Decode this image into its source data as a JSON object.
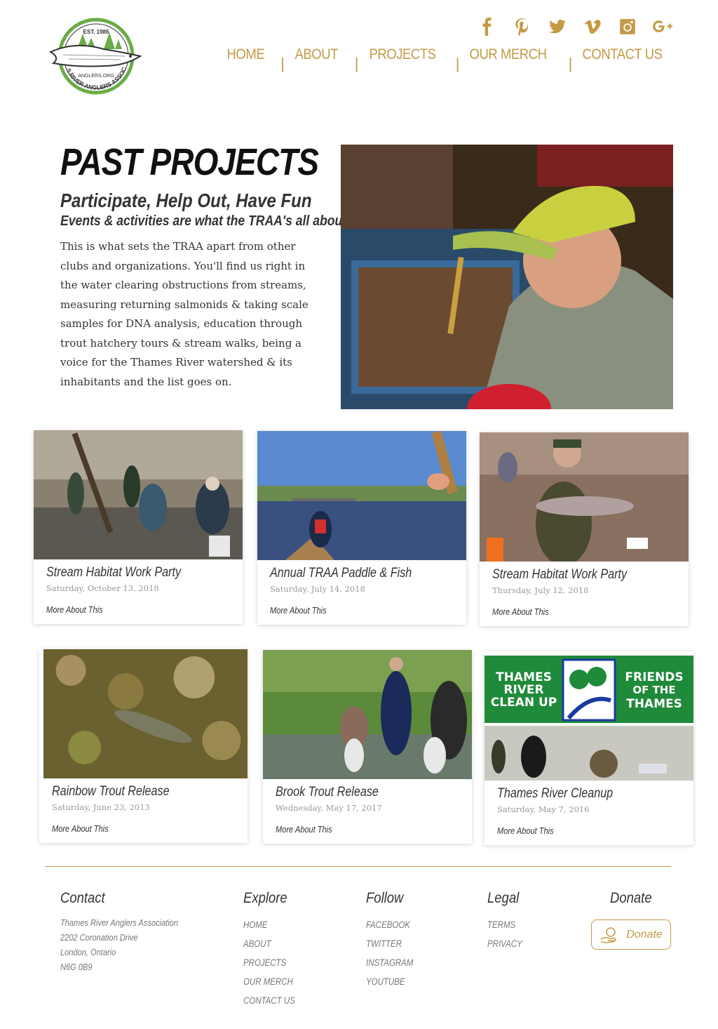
{
  "brand": {
    "est": "EST. 1986",
    "site": "ANGLERS.ORG",
    "name": "THAMES RIVER ANGLERS ASSOCIATION",
    "green": "#6aac46",
    "gold": "#c49a45"
  },
  "social": [
    {
      "icon": "facebook-icon"
    },
    {
      "icon": "pinterest-icon"
    },
    {
      "icon": "twitter-icon"
    },
    {
      "icon": "vimeo-icon"
    },
    {
      "icon": "instagram-icon"
    },
    {
      "icon": "google-plus-icon"
    }
  ],
  "nav": {
    "home": "HOME",
    "about": "ABOUT",
    "projects": "PROJECTS",
    "merch": "OUR MERCH",
    "contact": "CONTACT US",
    "separator": "|"
  },
  "intro": {
    "title": "PAST PROJECTS",
    "subtitle": "Participate, Help Out, Have Fun",
    "subtitle2": "Events & activities are what the TRAA's all about",
    "body": "This is what sets the TRAA apart from other clubs and organizations. You'll find us right in the water clearing obstructions from streams, measuring returning salmonids & taking scale samples for DNA analysis, education through trout hatchery tours & stream walks, being a voice for the Thames River watershed & its inhabitants and the list goes on."
  },
  "projects": [
    {
      "title": "Stream Habitat Work Party",
      "date": "Saturday, October 13, 2018",
      "more": "More About This"
    },
    {
      "title": "Annual TRAA Paddle & Fish",
      "date": "Saturday, July 14, 2018",
      "more": "More About This"
    },
    {
      "title": "Stream Habitat Work Party",
      "date": "Thursday, July 12, 2018",
      "more": "More About This"
    },
    {
      "title": "Rainbow Trout Release",
      "date": "Saturday, June 23, 2013",
      "more": "More About This"
    },
    {
      "title": "Brook Trout Release",
      "date": "Wednesday, May 17, 2017",
      "more": "More About This"
    },
    {
      "title": "Thames River Cleanup",
      "date": "Saturday, May 7, 2016",
      "more": "More About This"
    }
  ],
  "cleanup_banner": {
    "left": [
      "THAMES",
      "RIVER",
      "CLEAN UP"
    ],
    "right": [
      "FRIENDS",
      "OF THE",
      "THAMES"
    ]
  },
  "footer": {
    "contact": {
      "heading": "Contact",
      "lines": [
        "Thames River Anglers Association",
        "2202 Coronation Drive",
        "London, Ontario",
        "N6G 0B9"
      ]
    },
    "explore": {
      "heading": "Explore",
      "links": [
        "HOME",
        "ABOUT",
        "PROJECTS",
        "OUR MERCH",
        "CONTACT US"
      ]
    },
    "follow": {
      "heading": "Follow",
      "links": [
        "FACEBOOK",
        "TWITTER",
        "INSTAGRAM",
        "YOUTUBE"
      ]
    },
    "legal": {
      "heading": "Legal",
      "links": [
        "TERMS",
        "PRIVACY"
      ]
    },
    "donate": {
      "heading": "Donate",
      "button": "Donate",
      "icon": "hand-money-icon"
    }
  }
}
